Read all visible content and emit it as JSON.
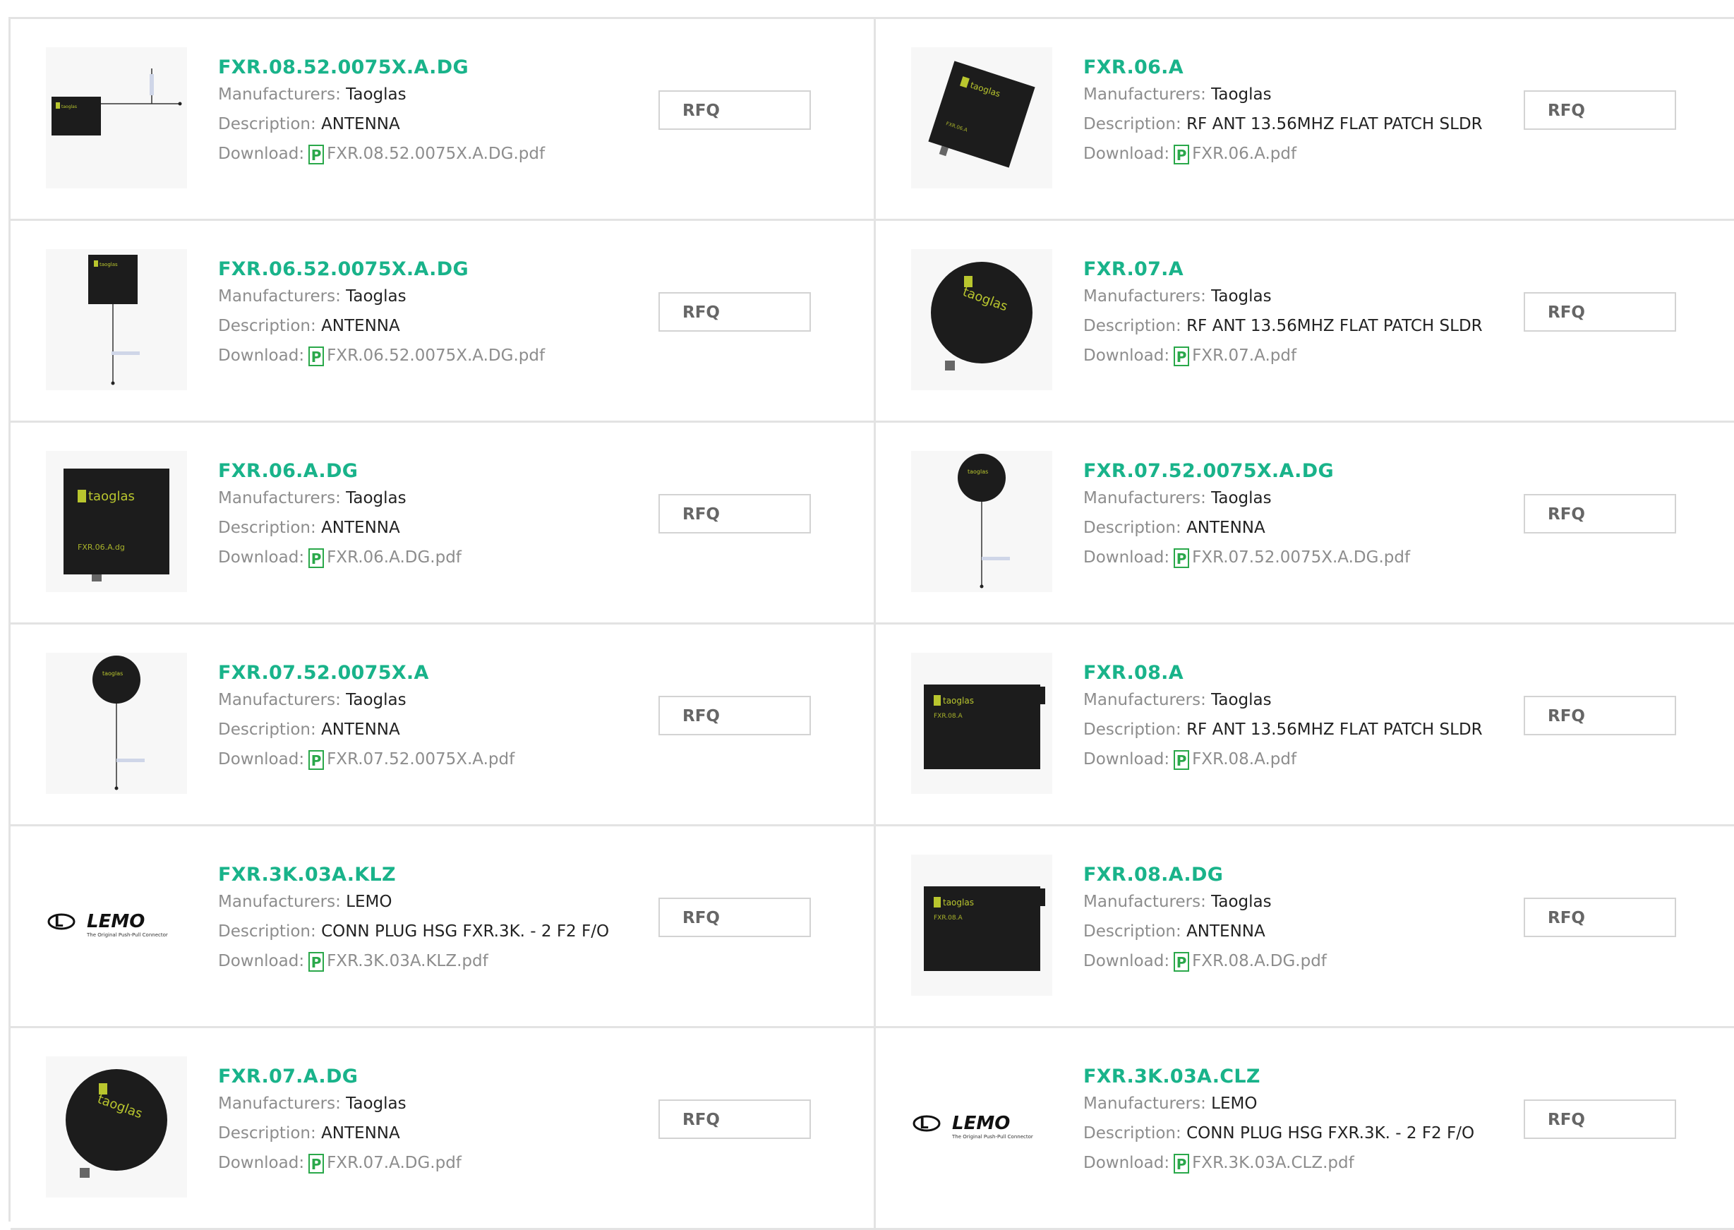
{
  "labels": {
    "manufacturers": "Manufacturers:",
    "description": "Description:",
    "download": "Download:",
    "rfq": "RFQ",
    "pdf_glyph": "P"
  },
  "products": [
    {
      "part": "FXR.08.52.0075X.A.DG",
      "manufacturer": "Taoglas",
      "description": "ANTENNA",
      "file": "FXR.08.52.0075X.A.DG.pdf",
      "image": "rect-antenna-tcable",
      "image_text": "taoglas"
    },
    {
      "part": "FXR.06.A",
      "manufacturer": "Taoglas",
      "description": "RF ANT 13.56MHZ FLAT PATCH SLDR",
      "file": "FXR.06.A.pdf",
      "image": "square-antenna-rotated",
      "image_text": "taoglas"
    },
    {
      "part": "FXR.06.52.0075X.A.DG",
      "manufacturer": "Taoglas",
      "description": "ANTENNA",
      "file": "FXR.06.52.0075X.A.DG.pdf",
      "image": "square-antenna-cable",
      "image_text": "taoglas"
    },
    {
      "part": "FXR.07.A",
      "manufacturer": "Taoglas",
      "description": "RF ANT 13.56MHZ FLAT PATCH SLDR",
      "file": "FXR.07.A.pdf",
      "image": "round-antenna",
      "image_text": "taoglas"
    },
    {
      "part": "FXR.06.A.DG",
      "manufacturer": "Taoglas",
      "description": "ANTENNA",
      "file": "FXR.06.A.DG.pdf",
      "image": "square-antenna",
      "image_text": "taoglas"
    },
    {
      "part": "FXR.07.52.0075X.A.DG",
      "manufacturer": "Taoglas",
      "description": "ANTENNA",
      "file": "FXR.07.52.0075X.A.DG.pdf",
      "image": "round-antenna-cable",
      "image_text": "taoglas"
    },
    {
      "part": "FXR.07.52.0075X.A",
      "manufacturer": "Taoglas",
      "description": "ANTENNA",
      "file": "FXR.07.52.0075X.A.pdf",
      "image": "round-antenna-cable",
      "image_text": "taoglas"
    },
    {
      "part": "FXR.08.A",
      "manufacturer": "Taoglas",
      "description": "RF ANT 13.56MHZ FLAT PATCH SLDR",
      "file": "FXR.08.A.pdf",
      "image": "rect-antenna",
      "image_text": "taoglas"
    },
    {
      "part": "FXR.3K.03A.KLZ",
      "manufacturer": "LEMO",
      "description": "CONN PLUG HSG FXR.3K. - 2 F2 F/O",
      "file": "FXR.3K.03A.KLZ.pdf",
      "image": "lemo-logo",
      "image_text": "LEMO",
      "image_subtext": "The Original Push-Pull Connector"
    },
    {
      "part": "FXR.08.A.DG",
      "manufacturer": "Taoglas",
      "description": "ANTENNA",
      "file": "FXR.08.A.DG.pdf",
      "image": "rect-antenna",
      "image_text": "taoglas"
    },
    {
      "part": "FXR.07.A.DG",
      "manufacturer": "Taoglas",
      "description": "ANTENNA",
      "file": "FXR.07.A.DG.pdf",
      "image": "round-antenna",
      "image_text": "taoglas"
    },
    {
      "part": "FXR.3K.03A.CLZ",
      "manufacturer": "LEMO",
      "description": "CONN PLUG HSG FXR.3K. - 2 F2 F/O",
      "file": "FXR.3K.03A.CLZ.pdf",
      "image": "lemo-logo",
      "image_text": "LEMO",
      "image_subtext": "The Original Push-Pull Connector"
    }
  ],
  "colors": {
    "title": "#19b38a",
    "label": "#8d8d8d",
    "value": "#222222",
    "pdf_icon": "#2aa84a",
    "border": "#e3e3e3"
  }
}
